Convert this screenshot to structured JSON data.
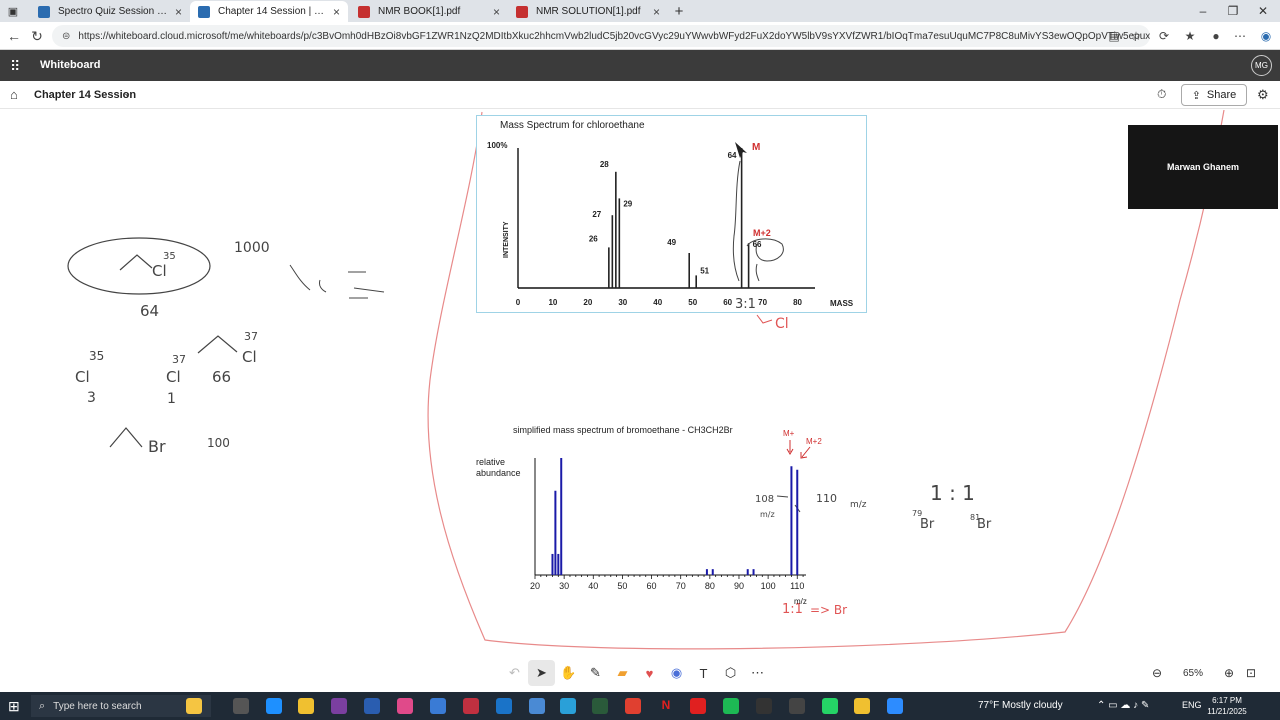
{
  "browser": {
    "tabs": [
      {
        "label": "Spectro Quiz Session | Microsoft W",
        "color": "#2b6cb0"
      },
      {
        "label": "Chapter 14 Session | Microsoft W",
        "color": "#2b6cb0"
      },
      {
        "label": "NMR BOOK[1].pdf",
        "color": "#c53030"
      },
      {
        "label": "NMR SOLUTION[1].pdf",
        "color": "#c53030"
      }
    ],
    "url": "https://whiteboard.cloud.microsoft/me/whiteboards/p/c3BvOmh0dHBzOi8vbGF1ZWR1NzQ2MDItbXkuc2hhcmVwb2ludC5jb20vcGVyc29uYWwvbWFyd2FuX2doYW5lbV9sYXVfZWR1/bIOqTma7esuUquMC7P8C8uMivYS3ewOQpOpVTiw5epuxxAWDy0..."
  },
  "app": {
    "title": "Whiteboard",
    "avatar": "MG"
  },
  "board": {
    "title": "Chapter 14 Session",
    "share_label": "Share"
  },
  "video": {
    "name": "Marwan Ghanem"
  },
  "chart1": {
    "title": "Mass Spectrum for chloroethane",
    "y_axis_label": "INTENSITY",
    "y_top_label": "100%",
    "x_axis_label": "MASS",
    "m_label": "M",
    "m2_label": "M+2",
    "peak_labels": [
      "28",
      "29",
      "27",
      "26",
      "49",
      "51",
      "64",
      "66"
    ]
  },
  "chart2": {
    "title": "simplified mass spectrum of bromoethane - CH3CH2Br",
    "y_axis_label_1": "relative",
    "y_axis_label_2": "abundance",
    "x_axis_label": "m/z",
    "m_label": "M+",
    "m2_label": "M+2"
  },
  "chart_data": [
    {
      "type": "bar",
      "title": "Mass Spectrum for chloroethane",
      "xlabel": "MASS",
      "ylabel": "INTENSITY",
      "xlim": [
        0,
        85
      ],
      "ylim": [
        0,
        100
      ],
      "x_ticks": [
        0,
        10,
        20,
        30,
        40,
        50,
        60,
        70,
        80
      ],
      "x": [
        26,
        27,
        28,
        29,
        49,
        51,
        64,
        66
      ],
      "values": [
        29,
        52,
        83,
        64,
        25,
        9,
        100,
        32
      ]
    },
    {
      "type": "bar",
      "title": "simplified mass spectrum of bromoethane - CH3CH2Br",
      "xlabel": "m/z",
      "ylabel": "relative abundance",
      "xlim": [
        20,
        113
      ],
      "ylim": [
        0,
        100
      ],
      "x_ticks": [
        20,
        30,
        40,
        50,
        60,
        70,
        80,
        90,
        100,
        110
      ],
      "x": [
        26,
        27,
        28,
        29,
        79,
        81,
        93,
        95,
        108,
        110
      ],
      "values": [
        18,
        72,
        18,
        100,
        5,
        5,
        5,
        5,
        93,
        90
      ]
    }
  ],
  "notes": {
    "cl35": "35",
    "cl_a": "Cl",
    "n1000": "1000",
    "n64": "64",
    "cl37": "37",
    "cl_b": "Cl",
    "iso35": "35",
    "iso_cl1": "Cl",
    "iso3": "3",
    "iso37": "37",
    "iso_cl2": "Cl",
    "iso66": "66",
    "iso1": "1",
    "br": "Br",
    "n100": "100",
    "ratio31": "3:1",
    "cl_red": "Cl",
    "n108": "108",
    "mz_a": "m/z",
    "n110": "110",
    "mz_b": "m/z",
    "ratio11": "1 : 1",
    "br79": "79",
    "br_a": "Br",
    "br81": "81",
    "br_b": "Br",
    "ratio11_red": "1:1",
    "arrow_br": "=> Br"
  },
  "zoom": "65%",
  "taskbar": {
    "search_placeholder": "Type here to search",
    "weather": "77°F  Mostly cloudy",
    "lang": "ENG",
    "time": "6:17 PM",
    "date": "11/21/2025"
  }
}
